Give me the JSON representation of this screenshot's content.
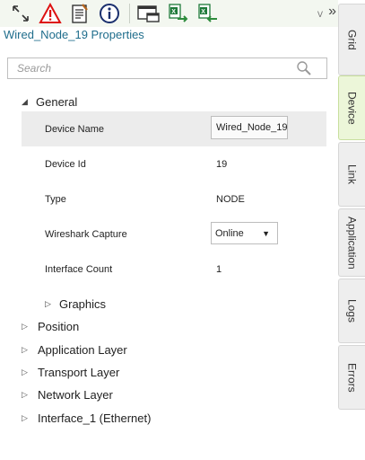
{
  "toolbar": {
    "icons": [
      "resize-arrows-icon",
      "warning-icon",
      "notes-icon",
      "info-icon",
      "window-arrange-icon",
      "excel-export-icon",
      "excel-import-icon"
    ],
    "overflow_indicator": "ᐯ",
    "more_label": "»"
  },
  "panel_title": "Wired_Node_19 Properties",
  "search": {
    "placeholder": "Search"
  },
  "general": {
    "label": "General",
    "rows": [
      {
        "label": "Device Name",
        "value": "Wired_Node_19"
      },
      {
        "label": "Device Id",
        "value": "19"
      },
      {
        "label": "Type",
        "value": "NODE"
      },
      {
        "label": "Wireshark Capture",
        "value": "Online"
      },
      {
        "label": "Interface Count",
        "value": "1"
      }
    ],
    "graphics_label": "Graphics"
  },
  "tree": [
    {
      "label": "Position"
    },
    {
      "label": "Application Layer"
    },
    {
      "label": "Transport Layer"
    },
    {
      "label": "Network Layer"
    },
    {
      "label": "Interface_1 (Ethernet)"
    }
  ],
  "tabs": [
    {
      "label": "Grid",
      "active": false
    },
    {
      "label": "Device",
      "active": true
    },
    {
      "label": "Link",
      "active": false
    },
    {
      "label": "Application",
      "active": false
    },
    {
      "label": "Logs",
      "active": false
    },
    {
      "label": "Errors",
      "active": false
    }
  ],
  "colors": {
    "title": "#1f6d8c",
    "active_tab": "#ecf6d9",
    "selected_row": "#ececec"
  }
}
